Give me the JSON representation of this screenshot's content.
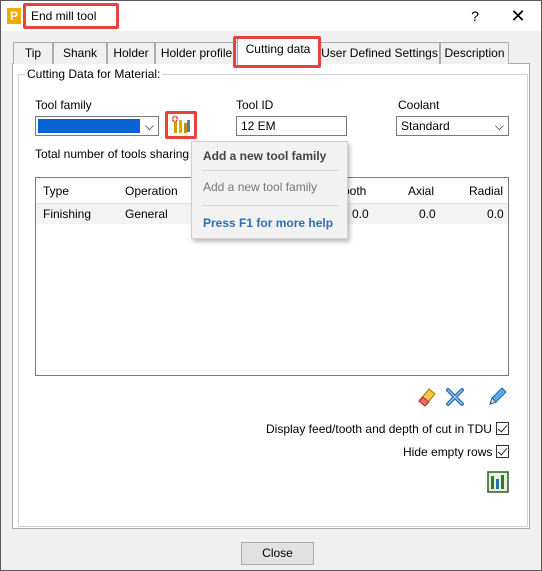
{
  "window": {
    "title": "End mill tool",
    "help_glyph": "?",
    "close_glyph": "✕",
    "app_icon_letter": "P"
  },
  "tabs": [
    {
      "label": "Tip"
    },
    {
      "label": "Shank"
    },
    {
      "label": "Holder"
    },
    {
      "label": "Holder profile"
    },
    {
      "label": "Cutting data",
      "active": true
    },
    {
      "label": "User Defined Settings"
    },
    {
      "label": "Description"
    }
  ],
  "group": {
    "label": "Cutting Data for Material:"
  },
  "fields": {
    "tool_family_label": "Tool family",
    "tool_id_label": "Tool ID",
    "tool_id_value": "12 EM",
    "coolant_label": "Coolant",
    "coolant_value": "Standard",
    "tools_sharing_label": "Total number of tools sharing"
  },
  "table": {
    "headers": [
      "Type",
      "Operation",
      "ooth",
      "Axial",
      "Radial"
    ],
    "rows": [
      {
        "type": "Finishing",
        "operation": "General",
        "tooth": "0.0",
        "axial": "0.0",
        "radial": "0.0"
      }
    ]
  },
  "options": {
    "display_feed": "Display feed/tooth and depth of cut in TDU",
    "hide_empty": "Hide empty rows"
  },
  "buttons": {
    "close": "Close"
  },
  "menu": {
    "title": "Add a new tool family",
    "item": "Add a new tool family",
    "help": "Press F1 for more help"
  },
  "colors": {
    "highlight": "#e8423d",
    "selection": "#0a63d6",
    "help_link": "#2e6fb0"
  },
  "icons": [
    "tool-family-icon",
    "eraser-icon",
    "delete-icon",
    "edit-pencil-icon",
    "tool-database-icon"
  ]
}
